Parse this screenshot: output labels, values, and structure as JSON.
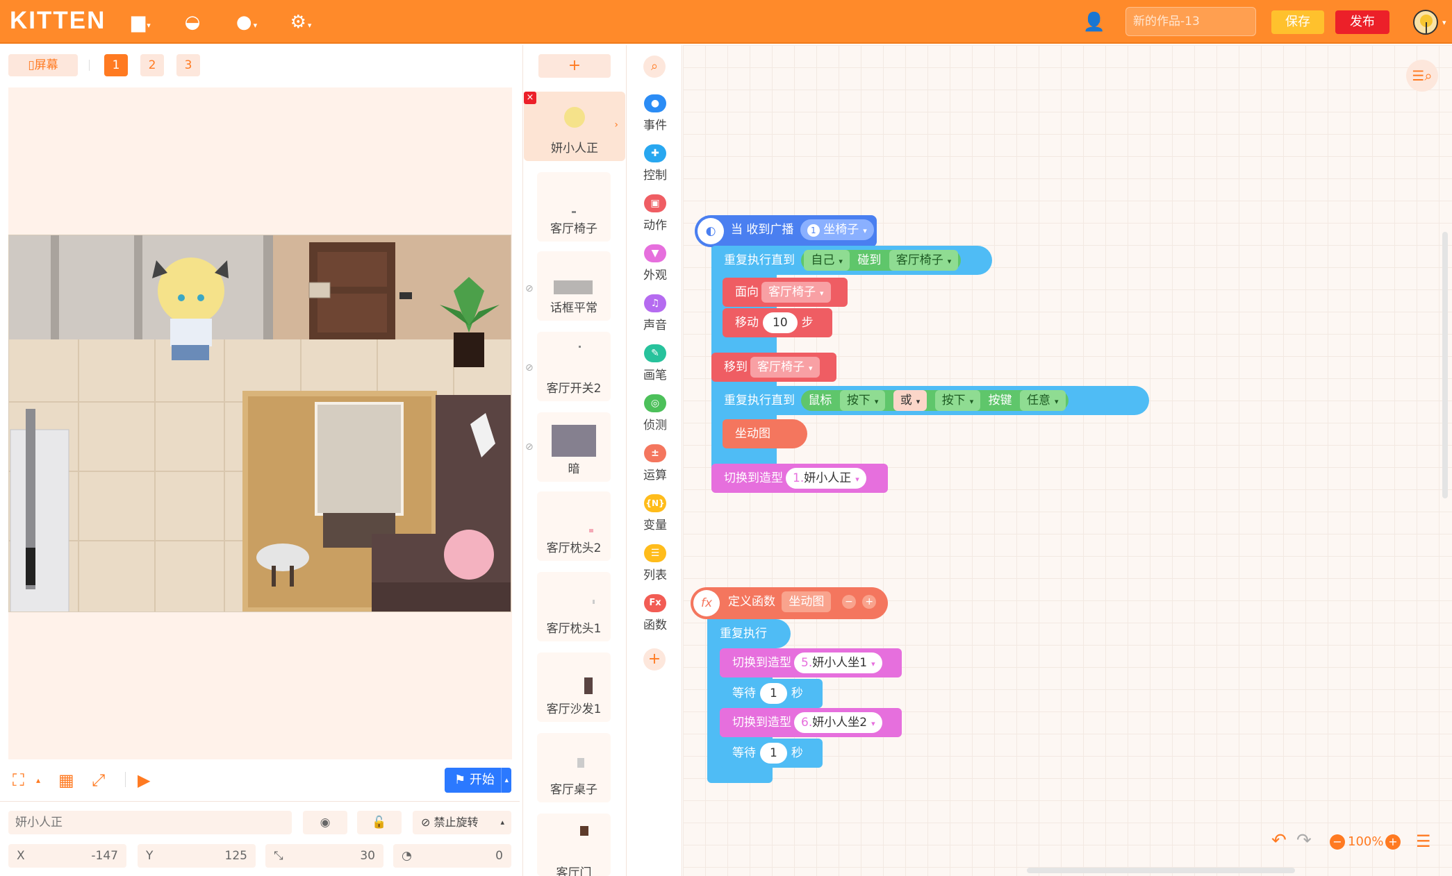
{
  "header": {
    "logo": "KITTEN",
    "work_name_placeholder": "新的作品-13",
    "save_label": "保存",
    "publish_label": "发布"
  },
  "stage": {
    "screen_tab": "屏幕",
    "screens": [
      "1",
      "2",
      "3"
    ],
    "start_label": "开始"
  },
  "sprite_props": {
    "name_placeholder": "妍小人正",
    "no_rotate_label": "禁止旋转",
    "x_label": "X",
    "x_value": "-147",
    "y_label": "Y",
    "y_value": "125",
    "size_value": "30",
    "rotation_value": "0"
  },
  "sprites": [
    "妍小人正",
    "客厅椅子",
    "话框平常",
    "客厅开关2",
    "暗",
    "客厅枕头2",
    "客厅枕头1",
    "客厅沙发1",
    "客厅桌子",
    "客厅门"
  ],
  "categories": [
    {
      "label": "事件",
      "color": "#2b8cf5"
    },
    {
      "label": "控制",
      "color": "#28a7f0"
    },
    {
      "label": "动作",
      "color": "#ef5d63"
    },
    {
      "label": "外观",
      "color": "#e66fdd"
    },
    {
      "label": "声音",
      "color": "#b56bf0"
    },
    {
      "label": "画笔",
      "color": "#27c29c"
    },
    {
      "label": "侦测",
      "color": "#4cc05a"
    },
    {
      "label": "运算",
      "color": "#f4765e"
    },
    {
      "label": "变量",
      "color": "#ffbc1b"
    },
    {
      "label": "列表",
      "color": "#ffbc1b"
    },
    {
      "label": "函数",
      "color": "#f25c54"
    }
  ],
  "blocks": {
    "when_receive": "当 收到广播",
    "msg_num": "1",
    "msg_name": "坐椅子",
    "repeat_until": "重复执行直到",
    "self": "自己",
    "touch": "碰到",
    "chair": "客厅椅子",
    "face": "面向",
    "move": "移动",
    "move_num": "10",
    "steps": "步",
    "move_to": "移到",
    "mouse": "鼠标",
    "pressed": "按下",
    "or": "或",
    "key": "按键",
    "any": "任意",
    "sit_anim": "坐动图",
    "switch_costume": "切换到造型",
    "costume1_num": "1.",
    "costume1": "妍小人正",
    "define_func": "定义函数",
    "func_name": "坐动图",
    "repeat_forever": "重复执行",
    "costume5_num": "5.",
    "costume5": "妍小人坐1",
    "wait": "等待",
    "wait_num": "1",
    "seconds": "秒",
    "costume6_num": "6.",
    "costume6": "妍小人坐2"
  },
  "zoom": "100%"
}
